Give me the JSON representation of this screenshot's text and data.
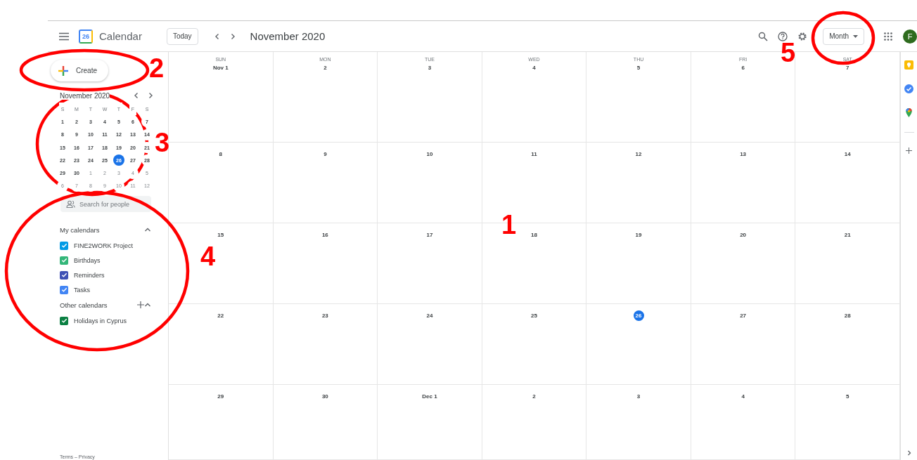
{
  "header": {
    "logo_text": "26",
    "app_name": "Calendar",
    "today_button": "Today",
    "title": "November 2020",
    "view": "Month",
    "avatar": "F"
  },
  "sidebar": {
    "create": "Create",
    "mini_calendar": {
      "title": "November 2020",
      "weekdays": [
        "S",
        "M",
        "T",
        "W",
        "T",
        "F",
        "S"
      ],
      "weeks": [
        [
          {
            "d": "1",
            "outside": false,
            "selected": false
          },
          {
            "d": "2",
            "outside": false,
            "selected": false
          },
          {
            "d": "3",
            "outside": false,
            "selected": false
          },
          {
            "d": "4",
            "outside": false,
            "selected": false
          },
          {
            "d": "5",
            "outside": false,
            "selected": false
          },
          {
            "d": "6",
            "outside": false,
            "selected": false
          },
          {
            "d": "7",
            "outside": false,
            "selected": false
          }
        ],
        [
          {
            "d": "8",
            "outside": false,
            "selected": false
          },
          {
            "d": "9",
            "outside": false,
            "selected": false
          },
          {
            "d": "10",
            "outside": false,
            "selected": false
          },
          {
            "d": "11",
            "outside": false,
            "selected": false
          },
          {
            "d": "12",
            "outside": false,
            "selected": false
          },
          {
            "d": "13",
            "outside": false,
            "selected": false
          },
          {
            "d": "14",
            "outside": false,
            "selected": false
          }
        ],
        [
          {
            "d": "15",
            "outside": false,
            "selected": false
          },
          {
            "d": "16",
            "outside": false,
            "selected": false
          },
          {
            "d": "17",
            "outside": false,
            "selected": false
          },
          {
            "d": "18",
            "outside": false,
            "selected": false
          },
          {
            "d": "19",
            "outside": false,
            "selected": false
          },
          {
            "d": "20",
            "outside": false,
            "selected": false
          },
          {
            "d": "21",
            "outside": false,
            "selected": false
          }
        ],
        [
          {
            "d": "22",
            "outside": false,
            "selected": false
          },
          {
            "d": "23",
            "outside": false,
            "selected": false
          },
          {
            "d": "24",
            "outside": false,
            "selected": false
          },
          {
            "d": "25",
            "outside": false,
            "selected": false
          },
          {
            "d": "26",
            "outside": false,
            "selected": true
          },
          {
            "d": "27",
            "outside": false,
            "selected": false
          },
          {
            "d": "28",
            "outside": false,
            "selected": false
          }
        ],
        [
          {
            "d": "29",
            "outside": false,
            "selected": false
          },
          {
            "d": "30",
            "outside": false,
            "selected": false
          },
          {
            "d": "1",
            "outside": true,
            "selected": false
          },
          {
            "d": "2",
            "outside": true,
            "selected": false
          },
          {
            "d": "3",
            "outside": true,
            "selected": false
          },
          {
            "d": "4",
            "outside": true,
            "selected": false
          },
          {
            "d": "5",
            "outside": true,
            "selected": false
          }
        ],
        [
          {
            "d": "6",
            "outside": true,
            "selected": false
          },
          {
            "d": "7",
            "outside": true,
            "selected": false
          },
          {
            "d": "8",
            "outside": true,
            "selected": false
          },
          {
            "d": "9",
            "outside": true,
            "selected": false
          },
          {
            "d": "10",
            "outside": true,
            "selected": false
          },
          {
            "d": "11",
            "outside": true,
            "selected": false
          },
          {
            "d": "12",
            "outside": true,
            "selected": false
          }
        ]
      ]
    },
    "search": {
      "placeholder": "Search for people"
    },
    "my_calendars": {
      "title": "My calendars",
      "items": [
        {
          "label": "FINE2WORK Project",
          "color": "#039be5",
          "checked": true
        },
        {
          "label": "Birthdays",
          "color": "#33b679",
          "checked": true
        },
        {
          "label": "Reminders",
          "color": "#3f51b5",
          "checked": true
        },
        {
          "label": "Tasks",
          "color": "#4285f4",
          "checked": true
        }
      ]
    },
    "other_calendars": {
      "title": "Other calendars",
      "items": [
        {
          "label": "Holidays in Cyprus",
          "color": "#0b8043",
          "checked": true
        }
      ]
    },
    "footer": "Terms – Privacy"
  },
  "grid": {
    "weekdays": [
      "SUN",
      "MON",
      "TUE",
      "WED",
      "THU",
      "FRI",
      "SAT"
    ],
    "weeks": [
      [
        {
          "d": "Nov 1",
          "today": false
        },
        {
          "d": "2",
          "today": false
        },
        {
          "d": "3",
          "today": false
        },
        {
          "d": "4",
          "today": false
        },
        {
          "d": "5",
          "today": false
        },
        {
          "d": "6",
          "today": false
        },
        {
          "d": "7",
          "today": false
        }
      ],
      [
        {
          "d": "8",
          "today": false
        },
        {
          "d": "9",
          "today": false
        },
        {
          "d": "10",
          "today": false
        },
        {
          "d": "11",
          "today": false
        },
        {
          "d": "12",
          "today": false
        },
        {
          "d": "13",
          "today": false
        },
        {
          "d": "14",
          "today": false
        }
      ],
      [
        {
          "d": "15",
          "today": false
        },
        {
          "d": "16",
          "today": false
        },
        {
          "d": "17",
          "today": false
        },
        {
          "d": "18",
          "today": false
        },
        {
          "d": "19",
          "today": false
        },
        {
          "d": "20",
          "today": false
        },
        {
          "d": "21",
          "today": false
        }
      ],
      [
        {
          "d": "22",
          "today": false
        },
        {
          "d": "23",
          "today": false
        },
        {
          "d": "24",
          "today": false
        },
        {
          "d": "25",
          "today": false
        },
        {
          "d": "26",
          "today": true
        },
        {
          "d": "27",
          "today": false
        },
        {
          "d": "28",
          "today": false
        }
      ],
      [
        {
          "d": "29",
          "today": false
        },
        {
          "d": "30",
          "today": false
        },
        {
          "d": "Dec 1",
          "today": false
        },
        {
          "d": "2",
          "today": false
        },
        {
          "d": "3",
          "today": false
        },
        {
          "d": "4",
          "today": false
        },
        {
          "d": "5",
          "today": false
        }
      ]
    ]
  },
  "annotations": [
    {
      "label": "1"
    },
    {
      "label": "2"
    },
    {
      "label": "3"
    },
    {
      "label": "4"
    },
    {
      "label": "5"
    }
  ]
}
